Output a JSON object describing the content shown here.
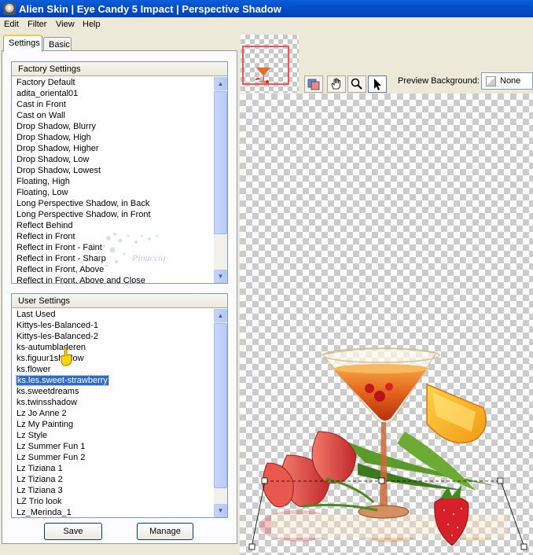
{
  "window": {
    "title": "Alien Skin  |  Eye Candy 5 Impact  |  Perspective Shadow"
  },
  "menu": [
    "Edit",
    "Filter",
    "View",
    "Help"
  ],
  "tabs": {
    "settings": "Settings",
    "basic": "Basic"
  },
  "factory": {
    "header": "Factory Settings",
    "items": [
      "Factory Default",
      "adita_oriental01",
      "Cast in Front",
      "Cast on Wall",
      "Drop Shadow, Blurry",
      "Drop Shadow, High",
      "Drop Shadow, Higher",
      "Drop Shadow, Low",
      "Drop Shadow, Lowest",
      "Floating, High",
      "Floating, Low",
      "Long Perspective Shadow, in Back",
      "Long Perspective Shadow, in Front",
      "Reflect Behind",
      "Reflect in Front",
      "Reflect in Front - Faint",
      "Reflect in Front - Sharp",
      "Reflect in Front, Above",
      "Reflect in Front, Above and Close"
    ]
  },
  "user": {
    "header": "User Settings",
    "selected_index": 6,
    "items": [
      "Last Used",
      "Kittys-les-Balanced-1",
      "Kittys-les-Balanced-2",
      "ks-autumbladeren",
      "ks.figuur1shadow",
      "ks.flower",
      "ks.les.sweet-strawberry",
      "ks.sweetdreams",
      "ks.twinsshadow",
      "Lz Jo Anne 2",
      "Lz My Painting",
      "Lz Style",
      "Lz Summer Fun 1",
      "Lz Summer Fun 2",
      "Lz Tiziana 1",
      "Lz Tiziana 2",
      "Lz Tiziana 3",
      "LZ Trio look",
      "Lz_Merinda_1"
    ]
  },
  "buttons": {
    "save": "Save",
    "manage": "Manage"
  },
  "watermark": {
    "text": "Pinuccia"
  },
  "preview": {
    "background_label": "Preview Background:",
    "background_value": "None"
  },
  "colors": {
    "selection": "#316ac5",
    "titlebar": "#0350c9",
    "thumb_frame": "#ee5555"
  }
}
